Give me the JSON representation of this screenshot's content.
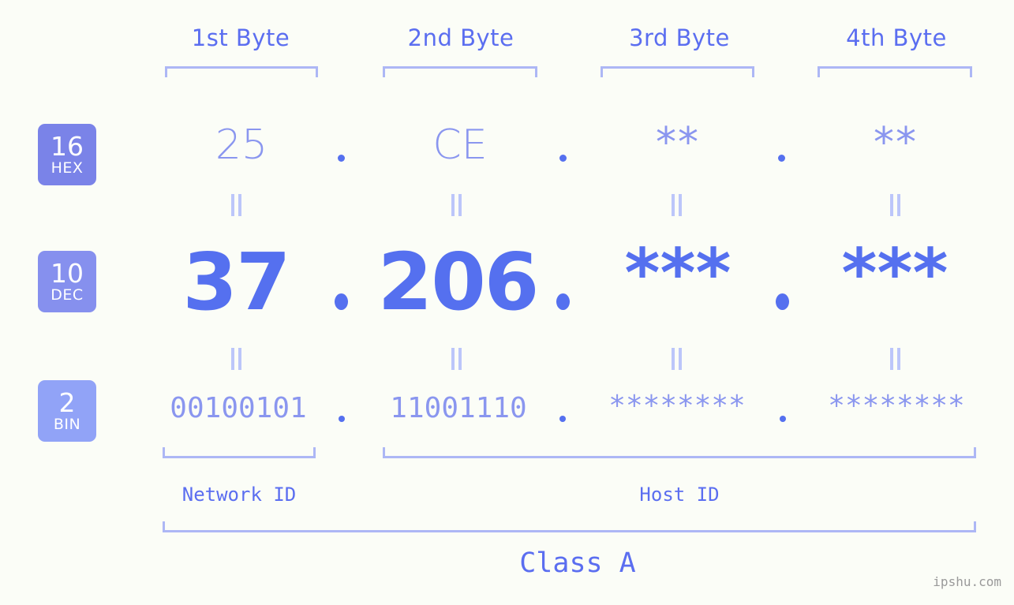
{
  "background_color": "#fbfdf7",
  "accent_color": "#5570ef",
  "muted_accent_color": "#8a96ef",
  "bracket_color": "#adb7f5",
  "byte_headers": [
    {
      "label": "1st Byte"
    },
    {
      "label": "2nd Byte"
    },
    {
      "label": "3rd Byte"
    },
    {
      "label": "4th Byte"
    }
  ],
  "bases": [
    {
      "number": "16",
      "abbr": "HEX",
      "color": "#7a83e8"
    },
    {
      "number": "10",
      "abbr": "DEC",
      "color": "#8690ee"
    },
    {
      "number": "2",
      "abbr": "BIN",
      "color": "#91a3f7"
    }
  ],
  "rows": {
    "hex": {
      "values": [
        "25",
        "CE",
        "**",
        "**"
      ],
      "separator": "."
    },
    "dec": {
      "values": [
        "37",
        "206",
        "***",
        "***"
      ],
      "separator": "."
    },
    "bin": {
      "values": [
        "00100101",
        "11001110",
        "********",
        "********"
      ],
      "separator": "."
    }
  },
  "equals_symbol": "=",
  "segments": {
    "network_id": "Network ID",
    "host_id": "Host ID"
  },
  "class_label": "Class A",
  "watermark": "ipshu.com"
}
